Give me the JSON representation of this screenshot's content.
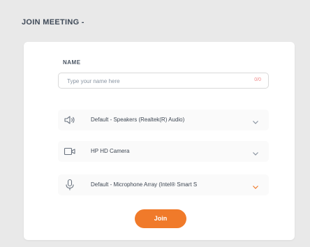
{
  "header": {
    "title": "JOIN MEETING -"
  },
  "form": {
    "name_label": "NAME",
    "name_placeholder": "Type your name here",
    "name_value": "",
    "char_count": "0/0",
    "speaker": {
      "icon": "speaker-icon",
      "value": "Default - Speakers (Realtek(R) Audio)"
    },
    "camera": {
      "icon": "camera-icon",
      "value": "HP HD Camera"
    },
    "microphone": {
      "icon": "microphone-icon",
      "value": "Default - Microphone Array (Intel® Smart S"
    },
    "join_label": "Join"
  },
  "colors": {
    "accent": "#f07a2a",
    "background": "#e9e9e9",
    "card": "#ffffff"
  }
}
